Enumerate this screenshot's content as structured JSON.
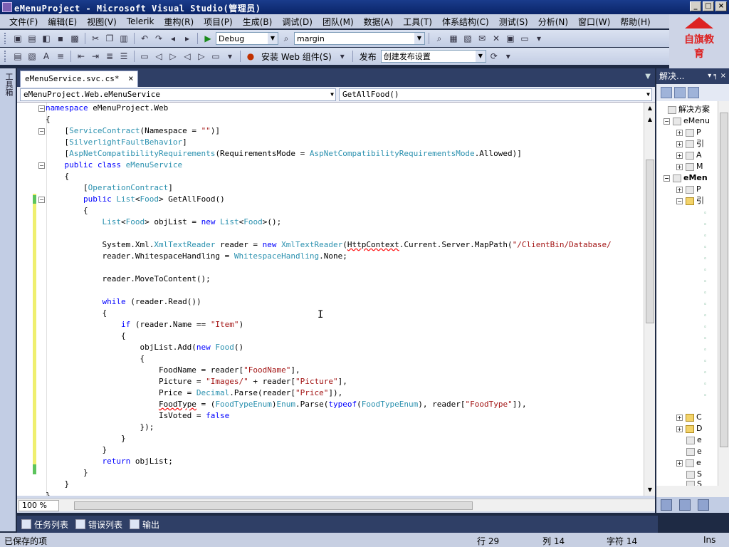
{
  "window": {
    "title": "eMenuProject - Microsoft Visual Studio(管理员)",
    "controls": [
      "_",
      "□",
      "×"
    ]
  },
  "menu": [
    "文件(F)",
    "编辑(E)",
    "视图(V)",
    "Telerik",
    "重构(R)",
    "项目(P)",
    "生成(B)",
    "调试(D)",
    "团队(M)",
    "数据(A)",
    "工具(T)",
    "体系结构(C)",
    "测试(S)",
    "分析(N)",
    "窗口(W)",
    "帮助(H)"
  ],
  "toolbar1": {
    "config_value": "Debug",
    "find_value": "margin"
  },
  "toolbar2": {
    "install_label": "安装 Web 组件(S)",
    "publish_label": "发布",
    "publish_profile_value": "创建发布设置"
  },
  "logo": {
    "text": "自旗教育"
  },
  "left_strip": {
    "label": "工具箱"
  },
  "editor": {
    "tab_label": "eMenuService.svc.cs*",
    "tab_close": "×",
    "class_combo": "eMenuProject.Web.eMenuService",
    "member_combo": "GetAllFood()",
    "zoom": "100 %",
    "lines": [
      "namespace eMenuProject.Web",
      "{",
      "    [ServiceContract(Namespace = \"\")]",
      "    [SilverlightFaultBehavior]",
      "    [AspNetCompatibilityRequirements(RequirementsMode = AspNetCompatibilityRequirementsMode.Allowed)]",
      "    public class eMenuService",
      "    {",
      "        [OperationContract]",
      "        public List<Food> GetAllFood()",
      "        {",
      "            List<Food> objList = new List<Food>();",
      "",
      "            System.Xml.XmlTextReader reader = new XmlTextReader(HttpContext.Current.Server.MapPath(\"/ClientBin/Database/",
      "            reader.WhitespaceHandling = WhitespaceHandling.None;",
      "",
      "            reader.MoveToContent();",
      "",
      "            while (reader.Read())",
      "            {",
      "                if (reader.Name == \"Item\")",
      "                {",
      "                    objList.Add(new Food()",
      "                    {",
      "                        FoodName = reader[\"FoodName\"],",
      "                        Picture = \"Images/\" + reader[\"Picture\"],",
      "                        Price = Decimal.Parse(reader[\"Price\"]),",
      "                        FoodType = (FoodTypeEnum)Enum.Parse(typeof(FoodTypeEnum), reader[\"FoodType\"]),",
      "                        IsVoted = false",
      "                    });",
      "                }",
      "            }",
      "            return objList;",
      "        }",
      "    }",
      "}"
    ]
  },
  "solution_explorer": {
    "title": "解决...",
    "pin": "▾ ╕ ×",
    "nodes": [
      {
        "text": "解决方案",
        "bold": false
      },
      {
        "text": "eMenu",
        "bold": false
      },
      {
        "text": "P",
        "bold": false
      },
      {
        "text": "引",
        "bold": false
      },
      {
        "text": "A",
        "bold": false
      },
      {
        "text": "M",
        "bold": false
      },
      {
        "text": "eMen",
        "bold": true
      },
      {
        "text": "P",
        "bold": false
      },
      {
        "text": "引",
        "bold": false
      },
      {
        "text": "C",
        "bold": false
      },
      {
        "text": "D",
        "bold": false
      },
      {
        "text": "e",
        "bold": false
      },
      {
        "text": "e",
        "bold": false
      },
      {
        "text": "e",
        "bold": false
      },
      {
        "text": "S",
        "bold": false
      },
      {
        "text": "S",
        "bold": false
      }
    ]
  },
  "bottom_tabs": [
    "任务列表",
    "错误列表",
    "输出"
  ],
  "status": {
    "message": "已保存的项",
    "line": "行 29",
    "col": "列 14",
    "ch": "字符 14",
    "mode": "Ins"
  }
}
